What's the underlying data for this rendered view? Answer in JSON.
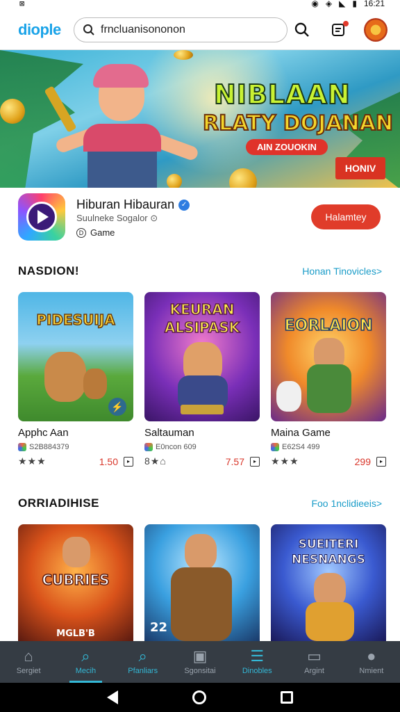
{
  "status": {
    "time": "16:21"
  },
  "header": {
    "logo": "diople",
    "search_value": "frncluanisononon"
  },
  "banner": {
    "title1": "NIBLAAN",
    "title2": "RLATY DOJANAN",
    "sub": "AIN ZOUOKIN",
    "button": "HONIV"
  },
  "app": {
    "title": "Hiburan Hibauran",
    "subtitle": "Suulneke Sogalor",
    "category": "Game",
    "install_label": "Halamtey"
  },
  "section1": {
    "title": "NASDION!",
    "link": "Honan Tinovicles>",
    "cards": [
      {
        "thumb_title": "PIDESUIJA",
        "name": "Apphc Aan",
        "meta": "S2B884379",
        "rating": "★★★",
        "price": "1.50"
      },
      {
        "thumb_title": "KEURAN ALSIPASK",
        "name": "Saltauman",
        "meta": "E0ncon 609",
        "rating": "8★⌂",
        "price": "7.57"
      },
      {
        "thumb_title": "EORLAION",
        "name": "Maina Game",
        "meta": "E62S4 499",
        "rating": "★★★",
        "price": "299"
      }
    ]
  },
  "section2": {
    "title": "ORRIADIHISE",
    "link": "Foo 1nclidieeis>",
    "cards": [
      {
        "thumb_title": "CUBRIES",
        "tag": "MGLB'B"
      },
      {
        "thumb_title": "22"
      },
      {
        "thumb_title": "SUEITERI NESNANGS"
      }
    ]
  },
  "nav": [
    {
      "label": "Sergiet",
      "icon": "home-icon",
      "glyph": "⌂"
    },
    {
      "label": "Mecih",
      "icon": "search-icon",
      "glyph": "⌕",
      "active": true
    },
    {
      "label": "Pfanliars",
      "icon": "explore-icon",
      "glyph": "⌕"
    },
    {
      "label": "Sgonsitai",
      "icon": "store-icon",
      "glyph": "▣"
    },
    {
      "label": "Dinobles",
      "icon": "library-icon",
      "glyph": "☰"
    },
    {
      "label": "Argint",
      "icon": "media-icon",
      "glyph": "▭"
    },
    {
      "label": "Nmient",
      "icon": "profile-icon",
      "glyph": "●"
    }
  ]
}
